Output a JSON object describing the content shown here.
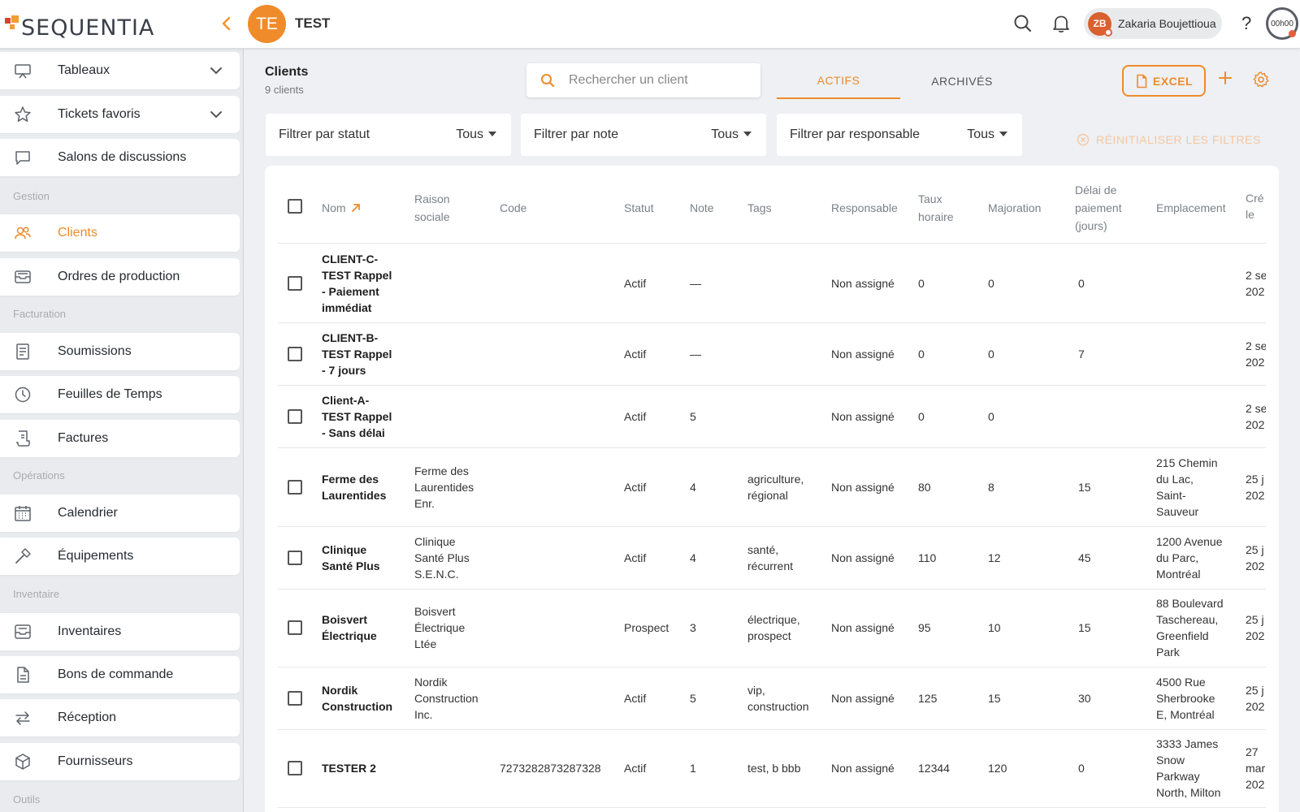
{
  "colors": {
    "accent": "#ef8b2a",
    "logo_orange": "#f39c32",
    "logo_red": "#d9432b",
    "user_avatar": "#d9602f"
  },
  "header": {
    "logo_text": "SEQUENTIA",
    "project_initials": "TE",
    "project_name": "TEST",
    "user_initials": "ZB",
    "user_name": "Zakaria Boujettioua",
    "help_label": "?",
    "timer": "00h00"
  },
  "sidebar": {
    "items": [
      {
        "label": "Tableaux",
        "icon": "monitor-icon"
      },
      {
        "label": "Tickets favoris",
        "icon": "star-icon"
      },
      {
        "label": "Salons de discussions",
        "icon": "chat-icon"
      },
      {
        "label": "Clients",
        "icon": "users-icon",
        "active": true
      },
      {
        "label": "Ordres de production",
        "icon": "tray-icon"
      },
      {
        "label": "Soumissions",
        "icon": "document-icon"
      },
      {
        "label": "Feuilles de Temps",
        "icon": "clock-icon"
      },
      {
        "label": "Factures",
        "icon": "invoice-icon"
      },
      {
        "label": "Calendrier",
        "icon": "calendar-icon"
      },
      {
        "label": "Équipements",
        "icon": "hammer-icon"
      },
      {
        "label": "Inventaires",
        "icon": "inbox-icon"
      },
      {
        "label": "Bons de commande",
        "icon": "file-icon"
      },
      {
        "label": "Réception",
        "icon": "arrows-icon"
      },
      {
        "label": "Fournisseurs",
        "icon": "box-icon"
      }
    ],
    "sections": [
      "Gestion",
      "Facturation",
      "Opérations",
      "Inventaire",
      "Outils"
    ]
  },
  "main": {
    "title": "Clients",
    "subtitle": "9 clients",
    "search_placeholder": "Rechercher un client",
    "tabs": [
      "ACTIFS",
      "ARCHIVÉS"
    ],
    "excel_label": "EXCEL",
    "filters": [
      {
        "label": "Filtrer par statut",
        "value": "Tous"
      },
      {
        "label": "Filtrer par note",
        "value": "Tous"
      },
      {
        "label": "Filtrer par responsable",
        "value": "Tous"
      }
    ],
    "reset_label": "RÉINITIALISER LES FILTRES"
  },
  "table": {
    "headers": {
      "nom": "Nom",
      "raison": [
        "Raison",
        "sociale"
      ],
      "code": "Code",
      "statut": "Statut",
      "note": "Note",
      "tags": "Tags",
      "responsable": "Responsable",
      "taux": [
        "Taux",
        "horaire"
      ],
      "majoration": "Majoration",
      "delai": [
        "Délai de",
        "paiement",
        "(jours)"
      ],
      "emplacement": "Emplacement",
      "cree": [
        "Cré",
        "le"
      ]
    },
    "rows": [
      {
        "nom": [
          "CLIENT-C-",
          "TEST Rappel",
          "- Paiement",
          "immédiat"
        ],
        "raison": [],
        "code": "",
        "statut": "Actif",
        "note": "—",
        "tags": [],
        "responsable": "Non assigné",
        "taux": "0",
        "majoration": "0",
        "delai": "0",
        "emplacement": [],
        "cree": [
          "2 se",
          "202"
        ]
      },
      {
        "nom": [
          "CLIENT-B-",
          "TEST Rappel",
          "- 7 jours"
        ],
        "raison": [],
        "code": "",
        "statut": "Actif",
        "note": "—",
        "tags": [],
        "responsable": "Non assigné",
        "taux": "0",
        "majoration": "0",
        "delai": "7",
        "emplacement": [],
        "cree": [
          "2 se",
          "202"
        ]
      },
      {
        "nom": [
          "Client-A-",
          "TEST Rappel",
          "- Sans délai"
        ],
        "raison": [],
        "code": "",
        "statut": "Actif",
        "note": "5",
        "tags": [],
        "responsable": "Non assigné",
        "taux": "0",
        "majoration": "0",
        "delai": "",
        "emplacement": [],
        "cree": [
          "2 se",
          "202"
        ]
      },
      {
        "nom": [
          "Ferme des",
          "Laurentides"
        ],
        "raison": [
          "Ferme des",
          "Laurentides",
          "Enr."
        ],
        "code": "",
        "statut": "Actif",
        "note": "4",
        "tags": [
          "agriculture,",
          "régional"
        ],
        "responsable": "Non assigné",
        "taux": "80",
        "majoration": "8",
        "delai": "15",
        "emplacement": [
          "215 Chemin",
          "du Lac,",
          "Saint-",
          "Sauveur"
        ],
        "cree": [
          "25 j",
          "202"
        ]
      },
      {
        "nom": [
          "Clinique",
          "Santé Plus"
        ],
        "raison": [
          "Clinique",
          "Santé Plus",
          "S.E.N.C."
        ],
        "code": "",
        "statut": "Actif",
        "note": "4",
        "tags": [
          "santé,",
          "récurrent"
        ],
        "responsable": "Non assigné",
        "taux": "110",
        "majoration": "12",
        "delai": "45",
        "emplacement": [
          "1200 Avenue",
          "du Parc,",
          "Montréal"
        ],
        "cree": [
          "25 j",
          "202"
        ]
      },
      {
        "nom": [
          "Boisvert",
          "Électrique"
        ],
        "raison": [
          "Boisvert",
          "Électrique",
          "Ltée"
        ],
        "code": "",
        "statut": "Prospect",
        "note": "3",
        "tags": [
          "électrique,",
          "prospect"
        ],
        "responsable": "Non assigné",
        "taux": "95",
        "majoration": "10",
        "delai": "15",
        "emplacement": [
          "88 Boulevard",
          "Taschereau,",
          "Greenfield",
          "Park"
        ],
        "cree": [
          "25 j",
          "202"
        ]
      },
      {
        "nom": [
          "Nordik",
          "Construction"
        ],
        "raison": [
          "Nordik",
          "Construction",
          "Inc."
        ],
        "code": "",
        "statut": "Actif",
        "note": "5",
        "tags": [
          "vip,",
          "construction"
        ],
        "responsable": "Non assigné",
        "taux": "125",
        "majoration": "15",
        "delai": "30",
        "emplacement": [
          "4500 Rue",
          "Sherbrooke",
          "E, Montréal"
        ],
        "cree": [
          "25 j",
          "202"
        ]
      },
      {
        "nom": [
          "TESTER 2"
        ],
        "raison": [],
        "code": "7273282873287328",
        "statut": "Actif",
        "note": "1",
        "tags": [
          "test, b bbb"
        ],
        "responsable": "Non assigné",
        "taux": "12344",
        "majoration": "120",
        "delai": "0",
        "emplacement": [
          "3333 James",
          "Snow",
          "Parkway",
          "North, Milton"
        ],
        "cree": [
          "27",
          "mar",
          "202"
        ]
      }
    ]
  }
}
